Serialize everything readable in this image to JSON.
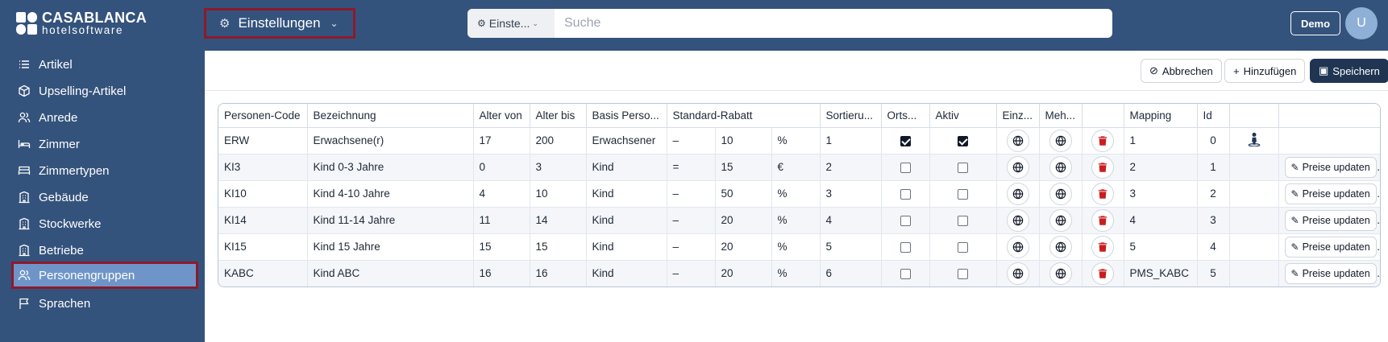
{
  "app": {
    "logo_line1": "CASABLANCA",
    "logo_line2": "hotelsoftware",
    "module_label": "Einstellungen",
    "search_scope": "Einste...",
    "search_placeholder": "Suche",
    "demo_label": "Demo",
    "avatar_initial": "U"
  },
  "sidebar": {
    "items": [
      {
        "label": "Artikel",
        "icon": "list-icon"
      },
      {
        "label": "Upselling-Artikel",
        "icon": "box-icon"
      },
      {
        "label": "Anrede",
        "icon": "users-icon"
      },
      {
        "label": "Zimmer",
        "icon": "bed-icon"
      },
      {
        "label": "Zimmertypen",
        "icon": "bed-icon"
      },
      {
        "label": "Gebäude",
        "icon": "building-icon"
      },
      {
        "label": "Stockwerke",
        "icon": "building-icon"
      },
      {
        "label": "Betriebe",
        "icon": "building-icon"
      },
      {
        "label": "Personengruppen",
        "icon": "users-icon",
        "active": true
      },
      {
        "label": "Sprachen",
        "icon": "flag-icon"
      }
    ]
  },
  "toolbar": {
    "cancel_label": "Abbrechen",
    "add_label": "Hinzufügen",
    "save_label": "Speichern"
  },
  "table": {
    "headers": [
      "Personen-Code",
      "Bezeichnung",
      "Alter von",
      "Alter bis",
      "Basis Perso...",
      "Standard-Rabatt",
      "Sortieru...",
      "Orts...",
      "Aktiv",
      "Einz...",
      "Meh...",
      "",
      "Mapping",
      "Id",
      "",
      ""
    ],
    "update_label": "Preise updaten",
    "rows": [
      {
        "code": "ERW",
        "name": "Erwachsene(r)",
        "age_from": "17",
        "age_to": "200",
        "basis": "Erwachsener",
        "sign": "–",
        "discount": "10",
        "unit": "%",
        "sort": "1",
        "ortstaxe": true,
        "active": true,
        "mapping": "1",
        "id": "0",
        "person_icon": true,
        "update": false
      },
      {
        "code": "KI3",
        "name": "Kind 0-3 Jahre",
        "age_from": "0",
        "age_to": "3",
        "basis": "Kind",
        "sign": "=",
        "discount": "15",
        "unit": "€",
        "sort": "2",
        "ortstaxe": false,
        "active": false,
        "mapping": "2",
        "id": "1",
        "person_icon": false,
        "update": true
      },
      {
        "code": "KI10",
        "name": "Kind 4-10 Jahre",
        "age_from": "4",
        "age_to": "10",
        "basis": "Kind",
        "sign": "–",
        "discount": "50",
        "unit": "%",
        "sort": "3",
        "ortstaxe": false,
        "active": false,
        "mapping": "3",
        "id": "2",
        "person_icon": false,
        "update": true
      },
      {
        "code": "KI14",
        "name": "Kind 11-14 Jahre",
        "age_from": "11",
        "age_to": "14",
        "basis": "Kind",
        "sign": "–",
        "discount": "20",
        "unit": "%",
        "sort": "4",
        "ortstaxe": false,
        "active": false,
        "mapping": "4",
        "id": "3",
        "person_icon": false,
        "update": true
      },
      {
        "code": "KI15",
        "name": "Kind 15 Jahre",
        "age_from": "15",
        "age_to": "15",
        "basis": "Kind",
        "sign": "–",
        "discount": "20",
        "unit": "%",
        "sort": "5",
        "ortstaxe": false,
        "active": false,
        "mapping": "5",
        "id": "4",
        "person_icon": false,
        "update": true
      },
      {
        "code": "KABC",
        "name": "Kind ABC",
        "age_from": "16",
        "age_to": "16",
        "basis": "Kind",
        "sign": "–",
        "discount": "20",
        "unit": "%",
        "sort": "6",
        "ortstaxe": false,
        "active": false,
        "mapping": "PMS_KABC",
        "id": "5",
        "person_icon": false,
        "update": true
      }
    ]
  },
  "colors": {
    "header_bg": "#34537c",
    "active_item": "#6f95c8",
    "highlight_border": "#8d1a2b",
    "primary_button": "#1f3552",
    "delete": "#c81e1e"
  }
}
